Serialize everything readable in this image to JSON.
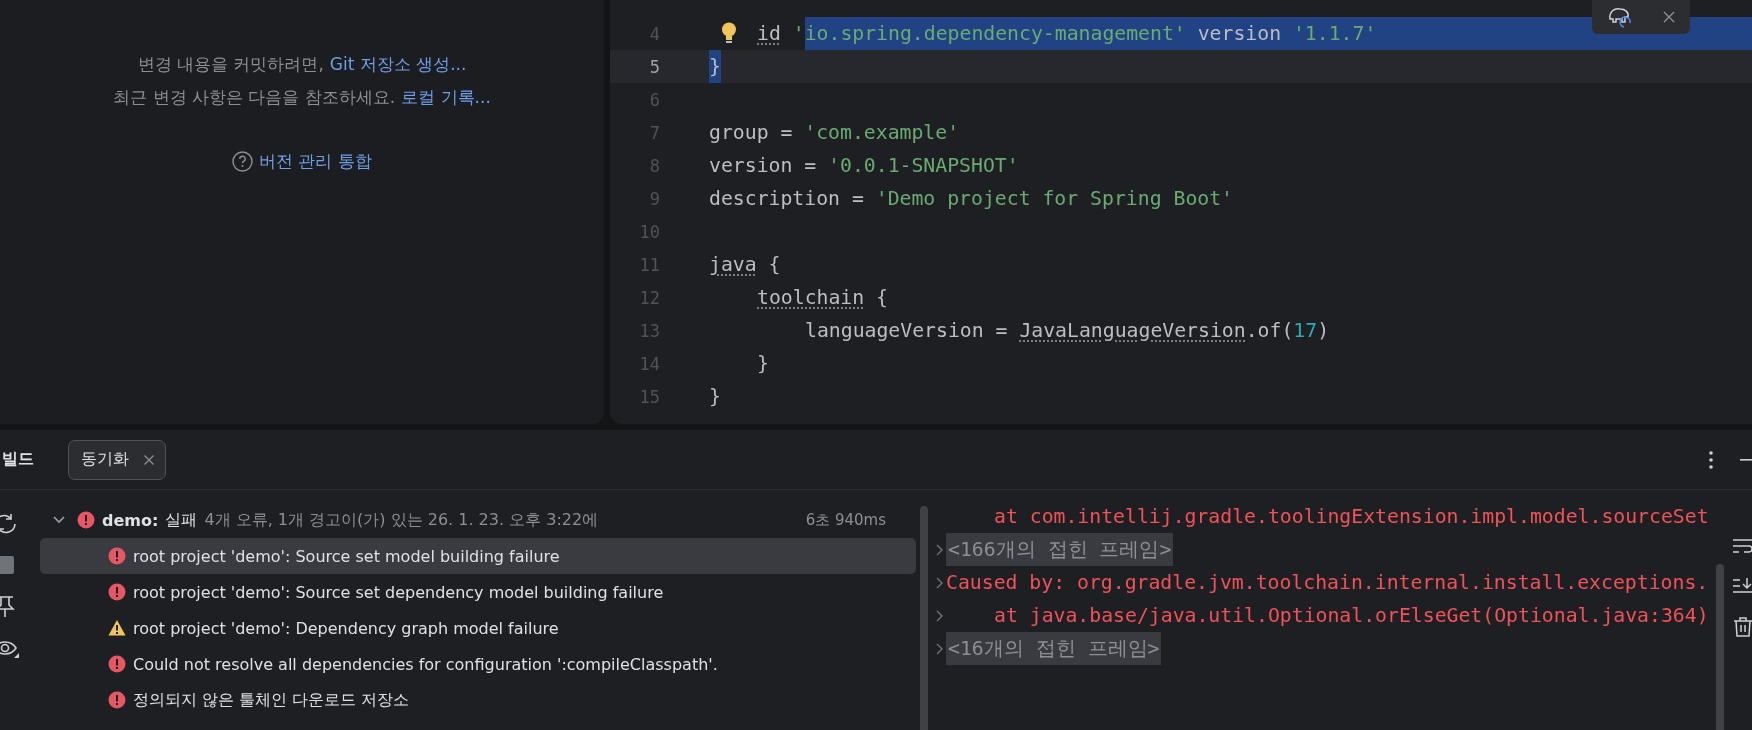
{
  "changes_panel": {
    "lines": [
      {
        "text": "변경 내용을 커밋하려면,",
        "link": "Git 저장소 생성..."
      },
      {
        "text": "최근 변경 사항은 다음을 참조하세요.",
        "link": "로컬 기록..."
      }
    ],
    "help_link": "버전 관리 통합"
  },
  "editor": {
    "lines": [
      {
        "number": "4",
        "kind": "nested",
        "current": false,
        "intention": true,
        "tokens": [
          {
            "text": "id",
            "kind": "symbol"
          },
          {
            "text": " '",
            "kind": "string"
          }
        ],
        "selected_tokens": [
          {
            "text": "io.spring.dependency-management'",
            "kind": "string"
          },
          {
            "text": " version ",
            "kind": "plain"
          },
          {
            "text": "'1.1.7'",
            "kind": "string"
          }
        ],
        "selection_continues": true
      },
      {
        "number": "5",
        "kind": "top",
        "current": true,
        "intention": false,
        "selected_tokens": [
          {
            "text": "}",
            "kind": "plain"
          }
        ],
        "selection_continues": false
      },
      {
        "number": "6",
        "current": false,
        "intention": false
      },
      {
        "number": "7",
        "kind": "top",
        "current": false,
        "intention": false,
        "tokens": [
          {
            "text": "group = ",
            "kind": "plain"
          },
          {
            "text": "'com.example'",
            "kind": "string"
          }
        ]
      },
      {
        "number": "8",
        "kind": "top",
        "current": false,
        "intention": false,
        "tokens": [
          {
            "text": "version = ",
            "kind": "plain"
          },
          {
            "text": "'0.0.1-SNAPSHOT'",
            "kind": "string"
          }
        ]
      },
      {
        "number": "9",
        "kind": "top",
        "current": false,
        "intention": false,
        "tokens": [
          {
            "text": "description = ",
            "kind": "plain"
          },
          {
            "text": "'Demo project for Spring Boot'",
            "kind": "string"
          }
        ]
      },
      {
        "number": "10",
        "current": false,
        "intention": false
      },
      {
        "number": "11",
        "kind": "top",
        "current": false,
        "intention": false,
        "tokens": [
          {
            "text": "java",
            "kind": "symbol"
          },
          {
            "text": " {",
            "kind": "plain"
          }
        ]
      },
      {
        "number": "12",
        "kind": "nested",
        "current": false,
        "intention": false,
        "tokens": [
          {
            "text": "toolchain",
            "kind": "symbol"
          },
          {
            "text": " {",
            "kind": "plain"
          }
        ]
      },
      {
        "number": "13",
        "kind": "nested2",
        "current": false,
        "intention": false,
        "tokens": [
          {
            "text": "languageVersion = ",
            "kind": "plain"
          },
          {
            "text": "JavaLanguageVersion",
            "kind": "symbol"
          },
          {
            "text": ".of(",
            "kind": "plain"
          },
          {
            "text": "17",
            "kind": "number"
          },
          {
            "text": ")",
            "kind": "plain"
          }
        ]
      },
      {
        "number": "14",
        "kind": "nested",
        "current": false,
        "intention": false,
        "tokens": [
          {
            "text": "}",
            "kind": "plain"
          }
        ]
      },
      {
        "number": "15",
        "kind": "top",
        "current": false,
        "intention": false,
        "tokens": [
          {
            "text": "}",
            "kind": "plain"
          }
        ]
      }
    ]
  },
  "build_panel": {
    "title": "빌드",
    "tabs": [
      {
        "label": "동기화",
        "selected": true
      }
    ],
    "tree": {
      "name": "demo:",
      "status": "실패",
      "summary": "4개 오류, 1개 경고이(가) 있는 26. 1. 23. 오후 3:22에",
      "duration": "6초 940ms",
      "expanded": true,
      "kind": "error",
      "children": [
        {
          "text": "root project 'demo': Source set model building failure",
          "kind": "error",
          "selected": true
        },
        {
          "text": "root project 'demo': Source set dependency model building failure",
          "kind": "error",
          "selected": false
        },
        {
          "text": "root project 'demo': Dependency graph model failure",
          "kind": "warning",
          "selected": false
        },
        {
          "text": "Could not resolve all dependencies for configuration ':compileClasspath'.",
          "kind": "error",
          "selected": false
        },
        {
          "text": "정의되지 않은 툴체인 다운로드 저장소",
          "kind": "error",
          "selected": false
        }
      ]
    },
    "console": {
      "lines": [
        {
          "text": "at com.intellij.gradle.toolingExtension.impl.model.sourceSet",
          "kind": "frame",
          "expandable": false
        },
        {
          "text": "<166개의 접힌 프레임>",
          "kind": "folded",
          "expandable": true
        },
        {
          "text": "Caused by: org.gradle.jvm.toolchain.internal.install.exceptions.",
          "kind": "error",
          "expandable": true
        },
        {
          "text": "at java.base/java.util.Optional.orElseGet(Optional.java:364)",
          "kind": "frame",
          "expandable": true
        },
        {
          "text": "<16개의 접힌 프레임>",
          "kind": "folded",
          "expandable": true
        }
      ]
    }
  }
}
